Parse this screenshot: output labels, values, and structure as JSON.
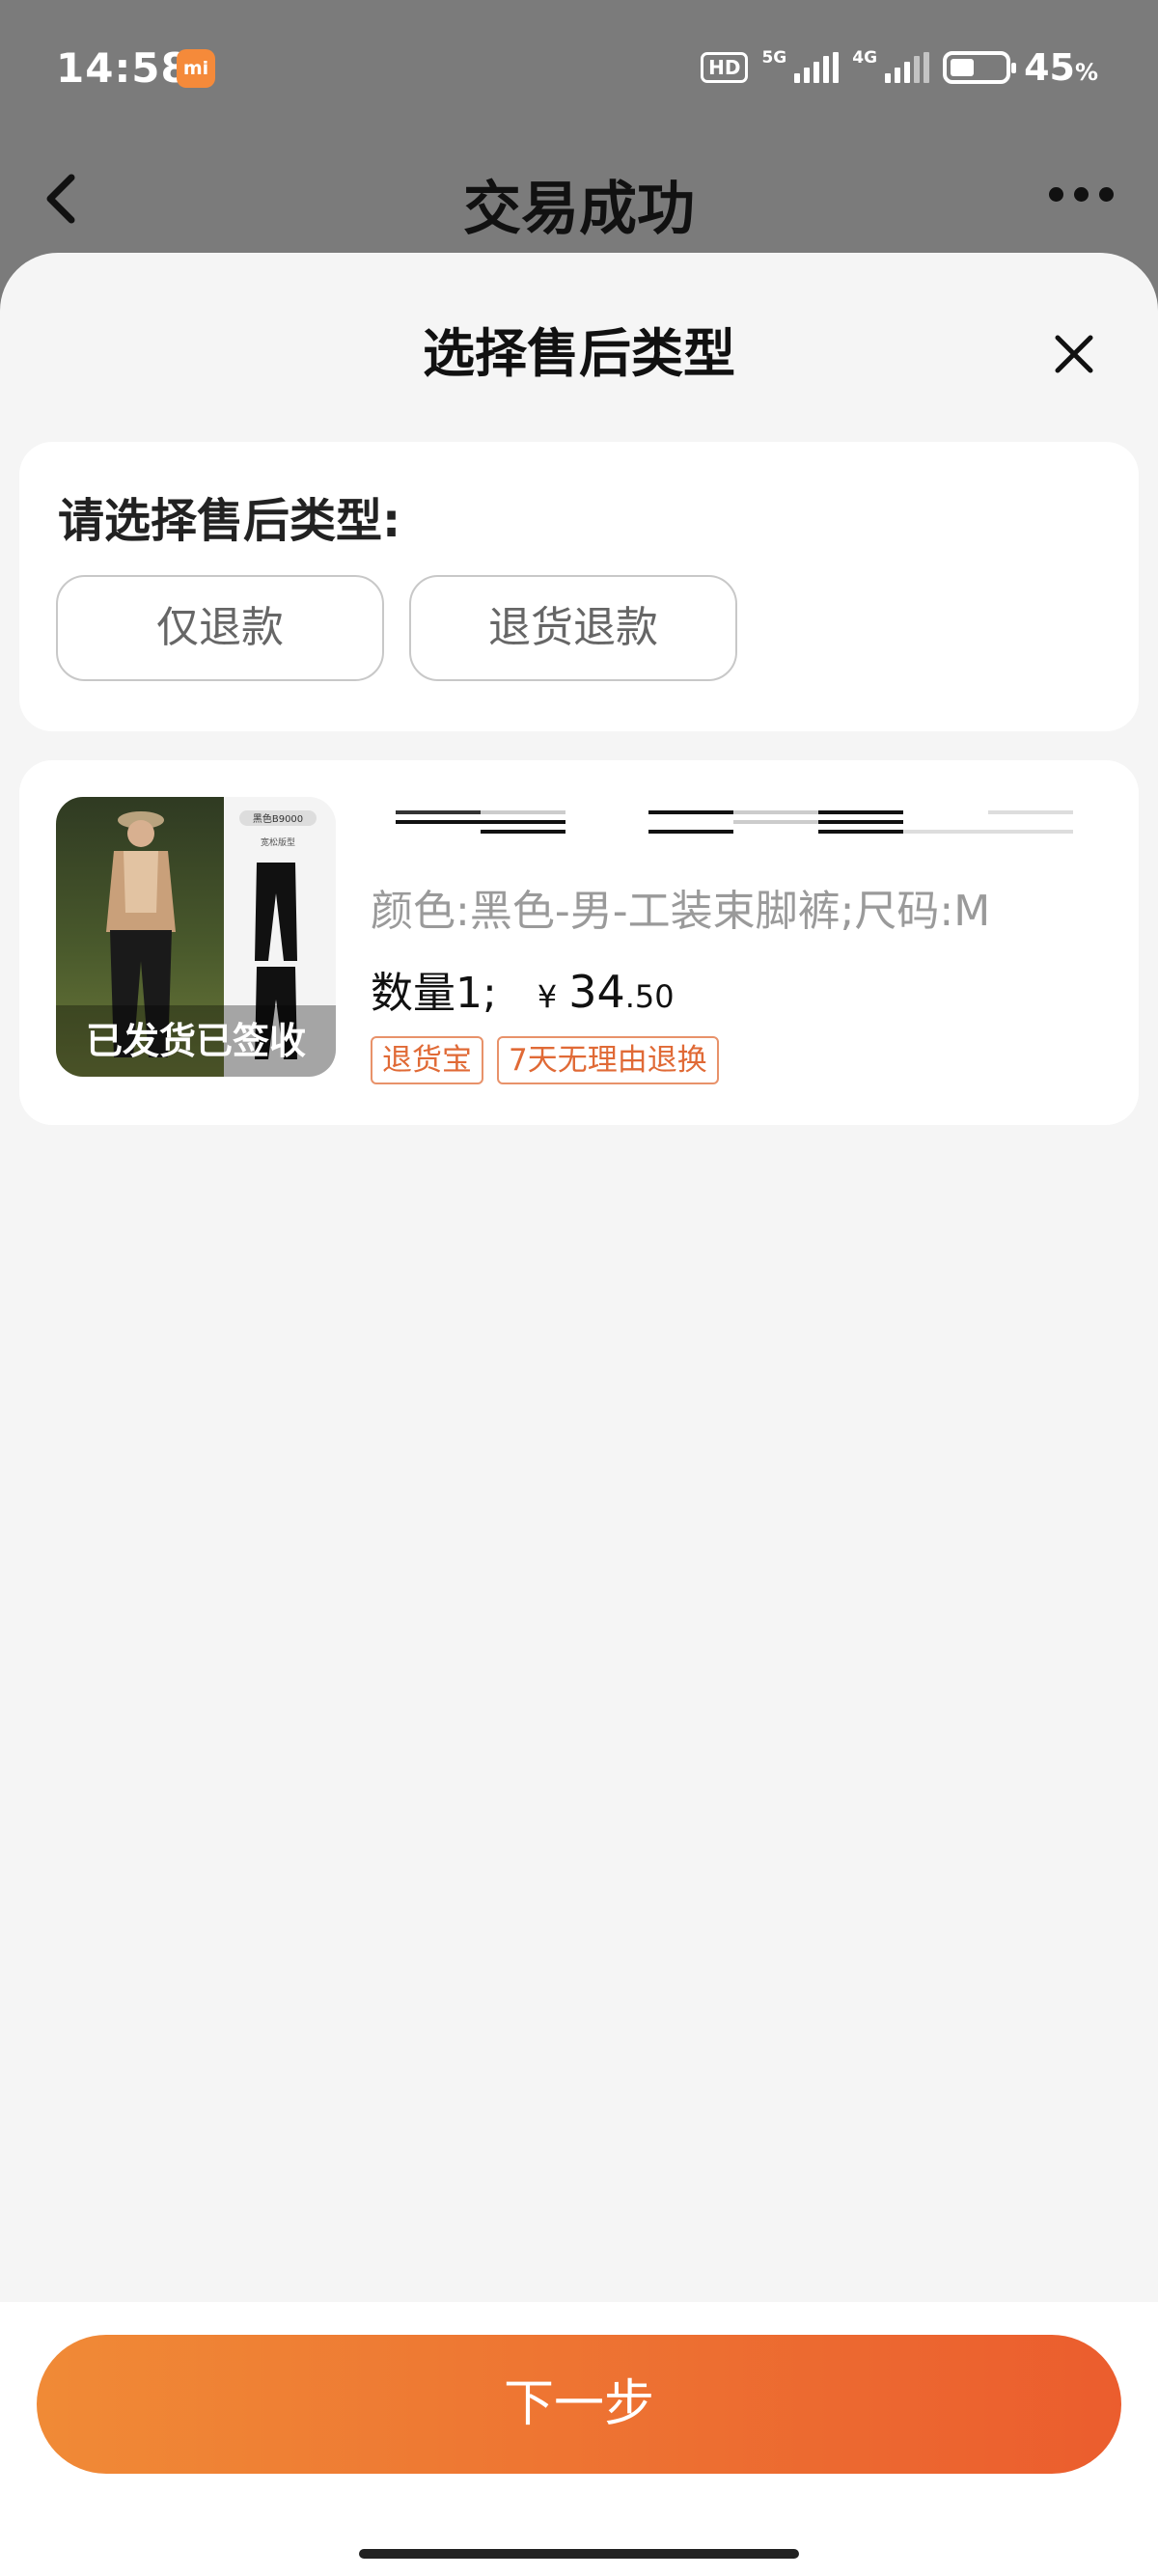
{
  "status_bar": {
    "time": "14:58",
    "mi_badge": "mi",
    "hd_label": "HD",
    "net_5g": "5G",
    "net_4g": "4G",
    "battery_percent": "45",
    "battery_unit": "%",
    "battery_level": 0.45
  },
  "header": {
    "title": "交易成功",
    "back_icon": "chevron-left-icon",
    "more_icon": "more-dots-icon"
  },
  "sheet": {
    "title": "选择售后类型",
    "close_icon": "close-icon"
  },
  "type_select": {
    "label": "请选择售后类型:",
    "options": [
      "仅退款",
      "退货退款"
    ]
  },
  "product": {
    "image_caption": "已发货已签收",
    "image_badge_color": "黑色B9000",
    "image_badge_fit": "宽松版型",
    "sku": "颜色:黑色-男-工装束脚裤;尺码:M",
    "quantity": "数量1;",
    "currency": "¥",
    "price_int": "34",
    "price_dec": ".50",
    "tags": [
      "退货宝",
      "7天无理由退换"
    ]
  },
  "footer": {
    "next_label": "下一步"
  },
  "colors": {
    "accent_start": "#f08a36",
    "accent_end": "#eb5d2e",
    "tag_color": "#e06a36"
  }
}
